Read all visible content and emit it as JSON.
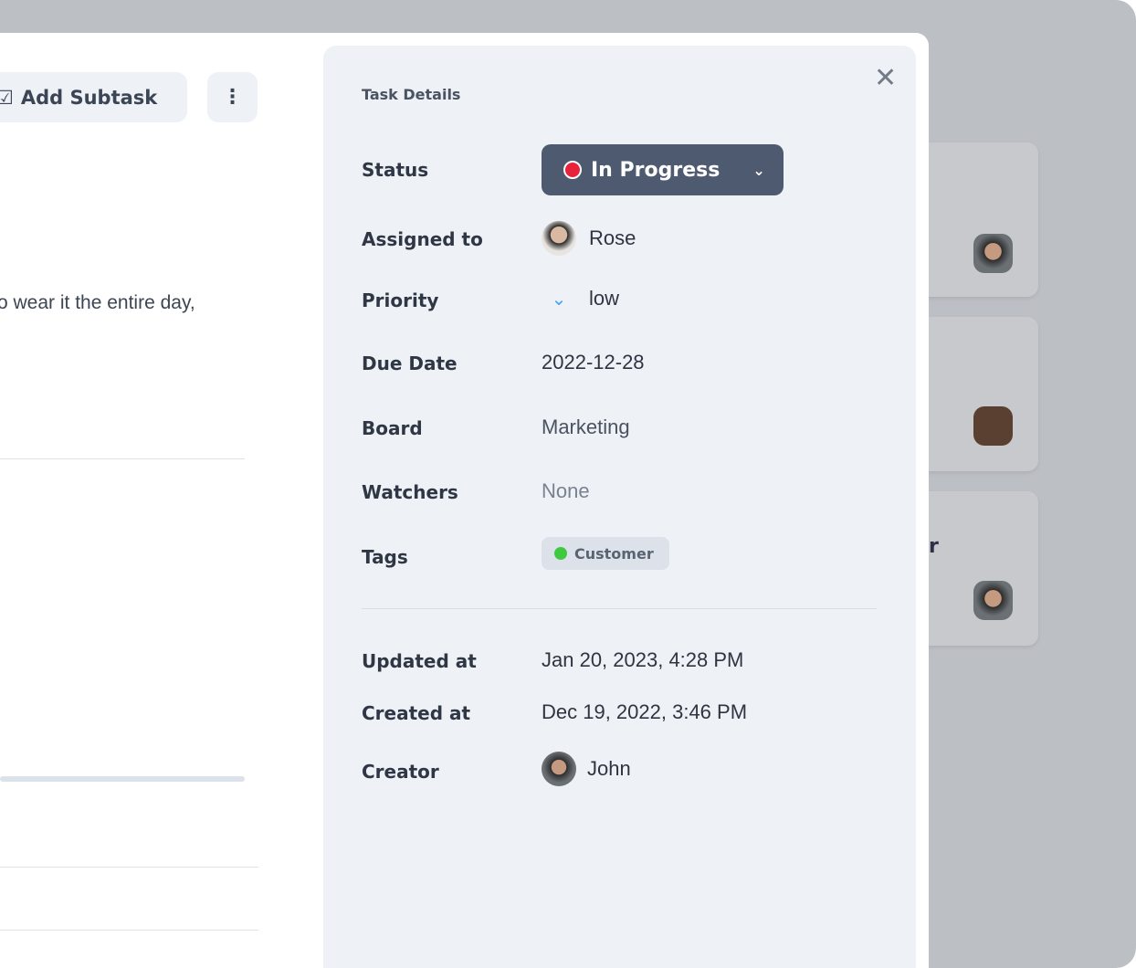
{
  "toolbar": {
    "add_subtask_label": "Add Subtask",
    "more_icon": "kebab-vertical-icon",
    "add_icon": "edit-square-icon"
  },
  "task": {
    "description_fragment": "o wear it the entire day,"
  },
  "panel": {
    "title": "Task Details",
    "fields": {
      "status_label": "Status",
      "status_value": "In Progress",
      "status_color": "#e8223a",
      "assigned_label": "Assigned to",
      "assigned_value": "Rose",
      "priority_label": "Priority",
      "priority_value": "low",
      "due_label": "Due Date",
      "due_value": "2022-12-28",
      "board_label": "Board",
      "board_value": "Marketing",
      "watchers_label": "Watchers",
      "watchers_value": "None",
      "tags_label": "Tags",
      "tag_value": "Customer",
      "tag_color": "#3ec93e",
      "updated_label": "Updated at",
      "updated_value": "Jan 20, 2023, 4:28 PM",
      "created_label": "Created at",
      "created_value": "Dec 19, 2022, 3:46 PM",
      "creator_label": "Creator",
      "creator_value": "John"
    }
  },
  "background": {
    "card_text_fragment": "r"
  }
}
